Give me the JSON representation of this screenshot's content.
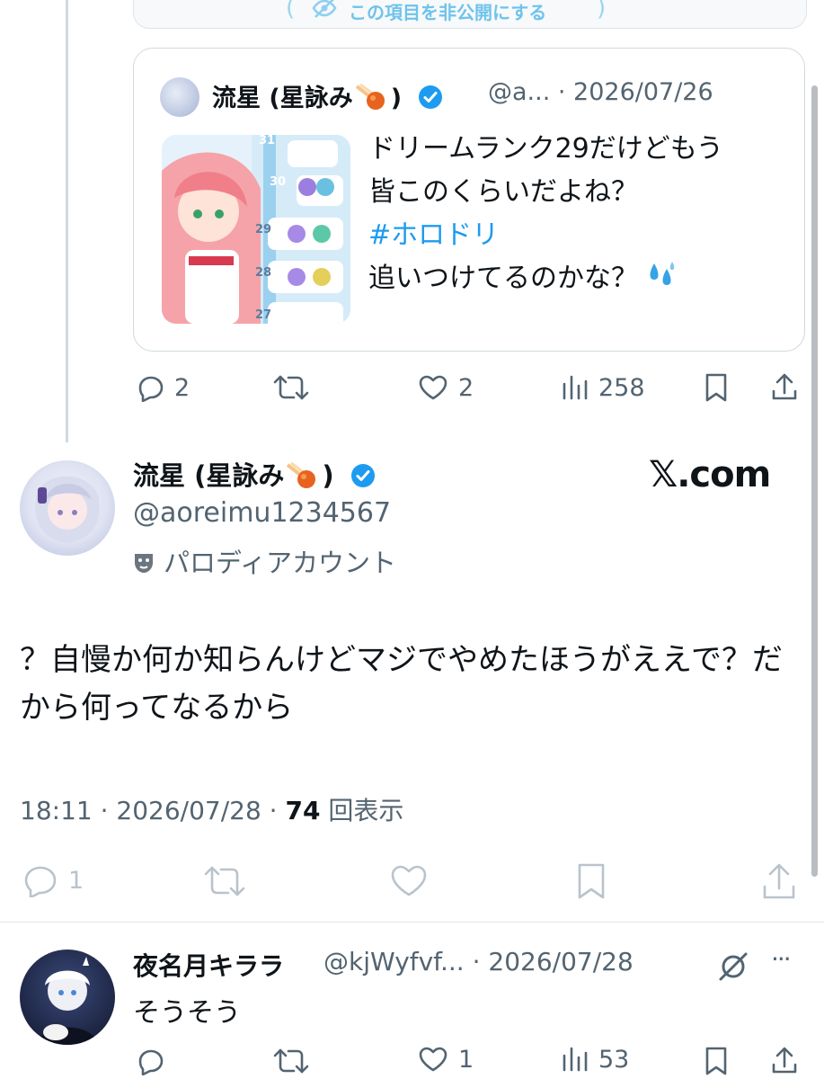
{
  "hide_banner": {
    "label": "この項目を非公開にする"
  },
  "quoted_tweet": {
    "name": "流星 (星詠み",
    "name_suffix": ")",
    "handle_date": "@a... · 2026/07/26",
    "lines": [
      "ドリームランク29だけどもう",
      "皆このくらいだよね？",
      "#ホロドリ",
      "追いつけてるのかな？"
    ],
    "thumb_levels": [
      "31",
      "30",
      "29",
      "28",
      "27"
    ]
  },
  "parent_actions": {
    "replies": "2",
    "likes": "2",
    "views": "258"
  },
  "main_tweet": {
    "name": "流星 (星詠み",
    "name_suffix": ")",
    "handle": "@aoreimu1234567",
    "parody_label": "パロディアカウント",
    "brand": "𝕏.com",
    "body": "？自慢か何か知らんけどマジでやめたほうがええで？だから何ってなるから",
    "meta_time": "18:11 · 2026/07/28 · ",
    "meta_views_count": "74",
    "meta_views_label": " 回表示"
  },
  "main_actions": {
    "replies": "1"
  },
  "reply": {
    "name": "夜名月キララ",
    "handle_date": "@kjWyfvf... · 2026/07/28",
    "more": "···",
    "body": "そうそう"
  },
  "reply_actions": {
    "likes": "1",
    "views": "53"
  },
  "colors": {
    "link": "#1d9bf0",
    "muted": "#536471",
    "verified": "#1d9bf0",
    "border": "#cfd9de"
  },
  "icons": [
    "eye-slash-icon",
    "verified-badge-icon",
    "meteor-emoji-icon",
    "sweat-drops-emoji-icon",
    "reply-icon",
    "retweet-icon",
    "like-icon",
    "views-icon",
    "bookmark-icon",
    "share-icon",
    "parody-mask-icon",
    "grok-icon"
  ]
}
